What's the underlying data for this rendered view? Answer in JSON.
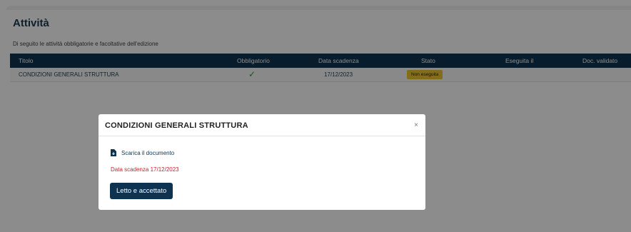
{
  "page": {
    "title": "Attività",
    "subtitle": "Di seguito le attività obbligatorie e facoltative dell'edizione"
  },
  "table": {
    "columns": [
      "Titolo",
      "Obbligatorio",
      "Data scadenza",
      "Stato",
      "Eseguita il",
      "Doc. validato"
    ],
    "rows": [
      {
        "titolo": "CONDIZIONI GENERALI STRUTTURA",
        "obbligatorio": "✓",
        "data_scadenza": "17/12/2023",
        "stato": "Non eseguita",
        "eseguita_il": "",
        "doc_validato": ""
      }
    ]
  },
  "modal": {
    "title": "CONDIZIONI GENERALI STRUTTURA",
    "close_label": "×",
    "download_label": "Scarica il documento",
    "deadline_text": "Data scadenza 17/12/2023",
    "accept_label": "Letto e accettato"
  },
  "colors": {
    "header_bg": "#0e3350",
    "badge_bg": "#f2c530",
    "deadline_text": "#c0242f",
    "check": "#2e9d3a"
  },
  "icons": {
    "download": "document-download-icon",
    "check": "check-icon",
    "close": "close-icon"
  }
}
